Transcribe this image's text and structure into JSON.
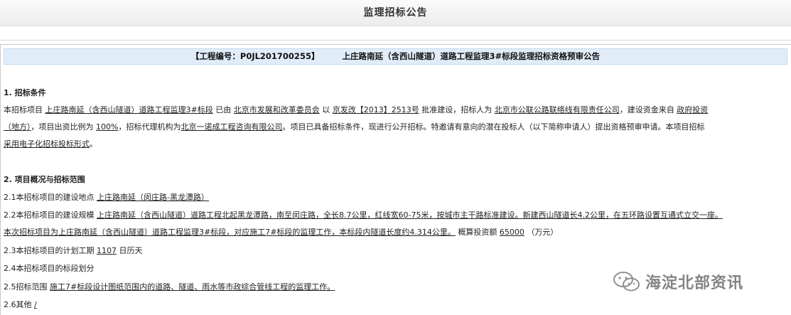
{
  "header": {
    "title": "监理招标公告"
  },
  "notice": {
    "code_label": "【工程编号：P0JL201700255】",
    "title": "上庄路南延（含西山隧道）道路工程监理3#标段监理招标资格预审公告"
  },
  "section1": {
    "heading": "1. 招标条件",
    "l1": {
      "a": "本招标项目",
      "project": "上庄路南延（含西山隧道）道路工程监理3#标段",
      "b": "已由",
      "approver": "北京市发展和改革委员会",
      "c": "以",
      "doc": "京发改【2013】2513号",
      "d": "批准建设，招标人为",
      "tenderer": "北京市公联公路联络线有限责任公司",
      "e": "，建设资金来自",
      "fund": "政府投资"
    },
    "l2": {
      "fund_cont": "（地方）",
      "a": "，项目出资比例为",
      "ratio": "100%",
      "b": "，招标代理机构为",
      "agency": "北京一诺成工程咨询有限公司",
      "c": "。项目已具备招标条件，现进行公开招标。特邀请有意向的潜在投标人（以下简称申请人）提出资格预审申请。本项目招标"
    },
    "l3": {
      "a": "采用",
      "method": "电子化招标投标形式",
      "b": "。"
    }
  },
  "section2": {
    "heading": "2. 项目概况与招标范围",
    "s21": {
      "num": "2.1",
      "label": "本招标项目的建设地点",
      "value": "上庄路南延（闵庄路-黑龙潭路）"
    },
    "s22": {
      "num": "2.2",
      "label": "本招标项目的建设规模",
      "line1": "上庄路南延（含西山隧道）道路工程北起黑龙潭路，南至闵庄路，全长8.7公里，红线宽60-75米，按城市主干路标准建设。新建西山隧道长4.2公里，在五环路设置互通式立交一座。",
      "line2": "本次招标项目为上庄路南延（含西山隧道）道路工程监理3#标段，对应施工7#标段的监理工作，本标段内隧道长度约4.314公里。",
      "invest_label": "概算投资额",
      "invest_value": "65000",
      "invest_unit": "（万元）"
    },
    "s23": {
      "num": "2.3",
      "label": "本招标项目的计划工期",
      "value": "1107",
      "unit": "日历天"
    },
    "s24": {
      "num": "2.4",
      "label": "本招标项目的标段划分"
    },
    "s25": {
      "num": "2.5",
      "label": "招标范围",
      "value": "施工7#标段设计图纸范围内的道路、隧道、雨水等市政综合管线工程的监理工作。"
    },
    "s26": {
      "num": "2.6",
      "label": "其他",
      "value": "/"
    }
  },
  "watermark": {
    "text": "海淀北部资讯",
    "icon": "wechat-icon"
  }
}
